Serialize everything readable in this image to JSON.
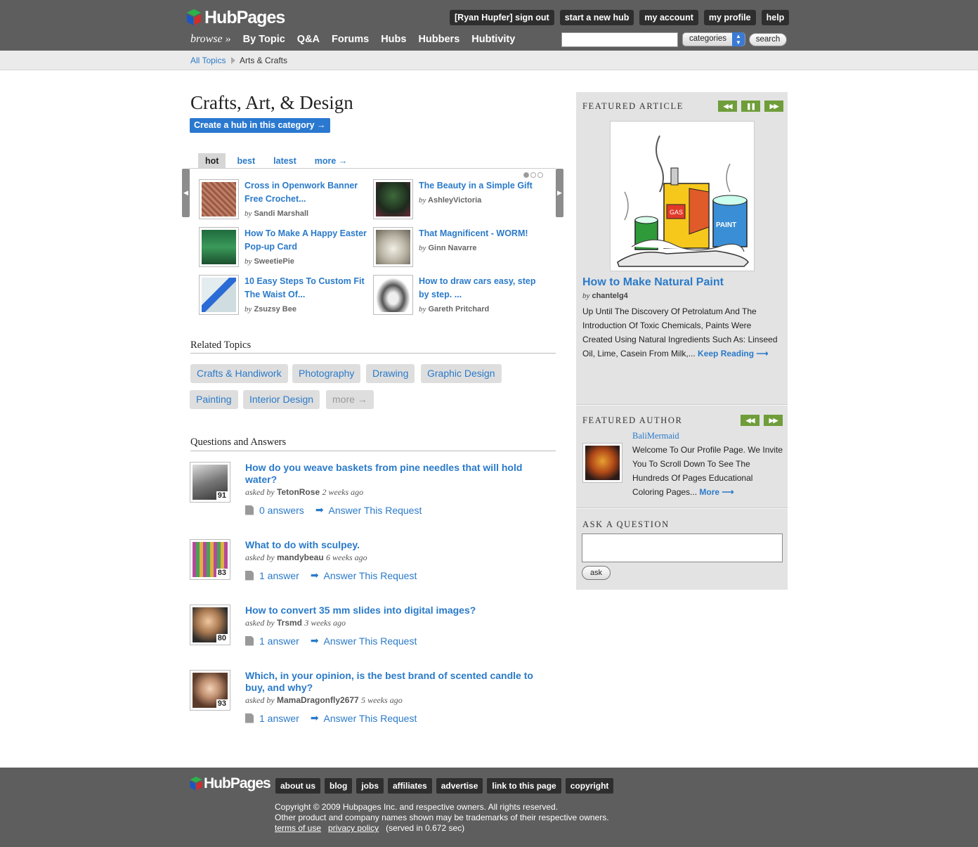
{
  "header": {
    "logo": "HubPages",
    "top_buttons": [
      "[Ryan Hupfer] sign out",
      "start a new hub",
      "my account",
      "my profile",
      "help"
    ],
    "browse_label": "browse »",
    "nav": [
      "By Topic",
      "Q&A",
      "Forums",
      "Hubs",
      "Hubbers",
      "Hubtivity"
    ],
    "search_value": "",
    "category_select": "categories",
    "search_button": "search"
  },
  "breadcrumb": {
    "root": "All Topics",
    "current": "Arts & Crafts"
  },
  "main": {
    "title": "Crafts, Art, & Design",
    "create_button": "Create a hub in this category →",
    "tabs": [
      "hot",
      "best",
      "latest",
      "more →"
    ],
    "active_tab": "hot",
    "hubs": [
      {
        "title": "Cross in Openwork Banner Free Crochet...",
        "by": "by",
        "author": "Sandi Marshall"
      },
      {
        "title": "The Beauty in a Simple Gift",
        "by": "by",
        "author": "AshleyVictoria"
      },
      {
        "title": "How To Make A Happy Easter Pop-up Card",
        "by": "by",
        "author": "SweetiePie"
      },
      {
        "title": "That Magnificent - WORM!",
        "by": "by",
        "author": "Ginn Navarre"
      },
      {
        "title": "10 Easy Steps To Custom Fit The Waist Of...",
        "by": "by",
        "author": "Zsuzsy Bee"
      },
      {
        "title": "How to draw cars easy, step by step. ...",
        "by": "by",
        "author": "Gareth Pritchard"
      }
    ],
    "related_heading": "Related Topics",
    "related": [
      "Crafts & Handiwork",
      "Photography",
      "Drawing",
      "Graphic Design",
      "Painting",
      "Interior Design",
      "more →"
    ],
    "qa_heading": "Questions and Answers",
    "questions": [
      {
        "title": "How do you weave baskets from pine needles that will hold water?",
        "asked": "asked by",
        "user": "TetonRose",
        "when": "2 weeks ago",
        "score": "91",
        "answers": "0 answers",
        "answer_link": "Answer This Request"
      },
      {
        "title": "What to do with sculpey.",
        "asked": "asked by",
        "user": "mandybeau",
        "when": "6 weeks ago",
        "score": "83",
        "answers": "1 answer",
        "answer_link": "Answer This Request"
      },
      {
        "title": "How to convert 35 mm slides into digital images?",
        "asked": "asked by",
        "user": "Trsmd",
        "when": "3 weeks ago",
        "score": "80",
        "answers": "1 answer",
        "answer_link": "Answer This Request"
      },
      {
        "title": "Which, in your opinion, is the best brand of scented candle to buy, and why?",
        "asked": "asked by",
        "user": "MamaDragonfly2677",
        "when": "5 weeks ago",
        "score": "93",
        "answers": "1 answer",
        "answer_link": "Answer This Request"
      }
    ]
  },
  "sidebar": {
    "featured_article_heading": "FEATURED ARTICLE",
    "article_title": "How to Make Natural Paint",
    "article_by": "by",
    "article_author": "chantelg4",
    "article_desc": "Up Until The Discovery Of Petrolatum And The Introduction Of Toxic Chemicals, Paints Were Created Using Natural Ingredients Such As: Linseed Oil, Lime, Casein From Milk,...",
    "keep_reading": "Keep Reading ⟶",
    "image_labels": {
      "gas": "GAS",
      "paint": "PAINT"
    },
    "featured_author_heading": "FEATURED AUTHOR",
    "author_name": "BaliMermaid",
    "author_desc": "Welcome To Our Profile Page. We Invite You To Scroll Down To See The Hundreds Of Pages Educational Coloring Pages...",
    "author_more": "More ⟶",
    "ask_heading": "ASK A QUESTION",
    "ask_value": "",
    "ask_button": "ask"
  },
  "footer": {
    "logo": "HubPages",
    "links": [
      "about us",
      "blog",
      "jobs",
      "affiliates",
      "advertise",
      "link to this page",
      "copyright"
    ],
    "copyright": "Copyright © 2009 Hubpages Inc. and respective owners. All rights reserved.",
    "trademark": "Other product and company names shown may be trademarks of their respective owners.",
    "terms": "terms of use",
    "privacy": "privacy policy",
    "served": "(served in 0.672 sec)"
  }
}
